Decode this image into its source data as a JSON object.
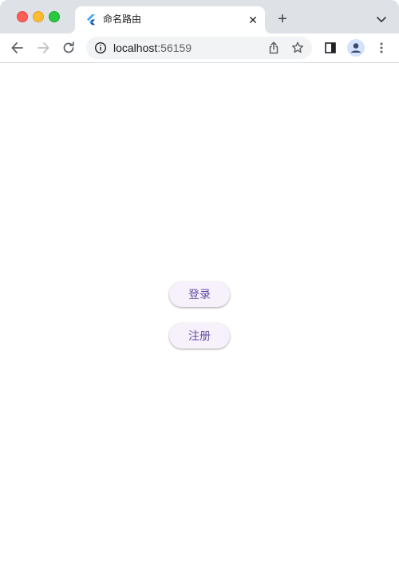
{
  "browser": {
    "tab": {
      "title": "命名路由",
      "favicon": "flutter-icon",
      "close_glyph": "✕"
    },
    "new_tab_glyph": "+",
    "address": {
      "host": "localhost",
      "port": ":56159"
    }
  },
  "app": {
    "buttons": {
      "login": "登录",
      "register": "注册"
    },
    "colors": {
      "button_bg": "#f7f1fb",
      "button_text": "#6750a4"
    }
  }
}
